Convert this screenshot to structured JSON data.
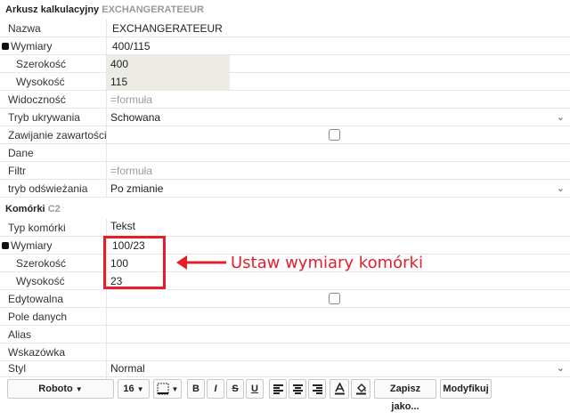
{
  "sheet": {
    "title": "Arkusz kalkulacyjny",
    "name": "EXCHANGERATEEUR"
  },
  "sheet_rows": [
    {
      "label": "Nazwa",
      "value": "EXCHANGERATEEUR"
    },
    {
      "label": "Wymiary",
      "value": "400/115"
    },
    {
      "label": "Szerokość",
      "value": "400"
    },
    {
      "label": "Wysokość",
      "value": "115"
    },
    {
      "label": "Widoczność",
      "value": "=formuła"
    },
    {
      "label": "Tryb ukrywania",
      "value": "Schowana"
    },
    {
      "label": "Zawijanie zawartości",
      "value": ""
    },
    {
      "label": "Dane",
      "value": ""
    },
    {
      "label": "Filtr",
      "value": "=formuła"
    },
    {
      "label": "tryb odświeżania",
      "value": "Po zmianie"
    }
  ],
  "cells": {
    "title": "Komórki",
    "ref": "C2"
  },
  "cell_rows": [
    {
      "label": "Typ komórki",
      "value": "Tekst"
    },
    {
      "label": "Wymiary",
      "value": "100/23"
    },
    {
      "label": "Szerokość",
      "value": "100"
    },
    {
      "label": "Wysokość",
      "value": "23"
    },
    {
      "label": "Edytowalna",
      "value": ""
    },
    {
      "label": "Pole danych",
      "value": ""
    },
    {
      "label": "Alias",
      "value": ""
    },
    {
      "label": "Wskazówka",
      "value": ""
    },
    {
      "label": "Styl",
      "value": "Normal"
    }
  ],
  "annotation": {
    "text": "Ustaw wymiary komórki",
    "color": "#e41e2b"
  },
  "toolbar": {
    "font": "Roboto",
    "size": "16",
    "bold": "B",
    "italic": "I",
    "strike": "S",
    "underline": "U",
    "save_as": "Zapisz jako...",
    "modify": "Modyfikuj"
  },
  "icons": [
    "bullet-square-icon",
    "chevron-down-icon",
    "checkbox-icon",
    "border-icon",
    "align-left-icon",
    "align-center-icon",
    "align-right-icon",
    "font-color-icon",
    "fill-color-icon",
    "arrow-left-icon"
  ]
}
